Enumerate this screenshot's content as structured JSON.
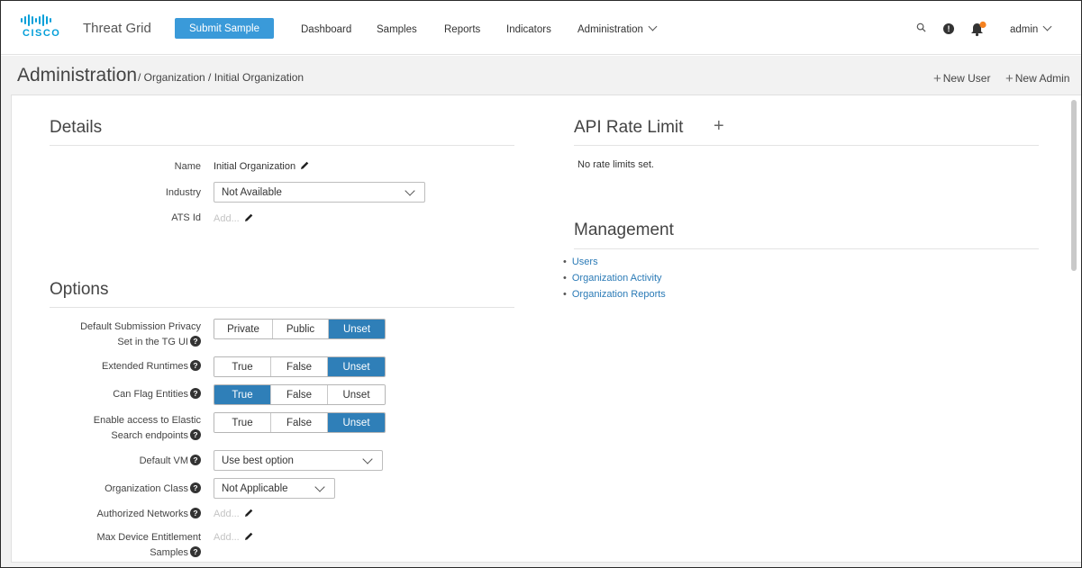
{
  "brand": {
    "logo_text": "CISCO",
    "app_title": "Threat Grid",
    "accent": "#3a9ad9"
  },
  "topnav": {
    "submit_label": "Submit Sample",
    "links": [
      "Dashboard",
      "Samples",
      "Reports",
      "Indicators",
      "Administration"
    ],
    "user": "admin",
    "icons": [
      "search-icon",
      "help-icon",
      "bell-icon"
    ]
  },
  "breadcrumb": {
    "root": "Administration",
    "rest": "/ Organization / Initial Organization"
  },
  "header_actions": {
    "new_user": "New User",
    "new_admin": "New Admin"
  },
  "details": {
    "title": "Details",
    "name_label": "Name",
    "name_value": "Initial Organization",
    "industry_label": "Industry",
    "industry_value": "Not Available",
    "ats_label": "ATS Id",
    "ats_placeholder": "Add..."
  },
  "options": {
    "title": "Options",
    "privacy_label_1": "Default Submission Privacy",
    "privacy_label_2": "Set in the TG UI",
    "privacy_opts": [
      "Private",
      "Public",
      "Unset"
    ],
    "extended_label": "Extended Runtimes",
    "extended_opts": [
      "True",
      "False",
      "Unset"
    ],
    "flag_label": "Can Flag Entities",
    "flag_opts": [
      "True",
      "False",
      "Unset"
    ],
    "elastic_label_1": "Enable access to Elastic",
    "elastic_label_2": "Search endpoints",
    "elastic_opts": [
      "True",
      "False",
      "Unset"
    ],
    "vm_label": "Default VM",
    "vm_value": "Use best option",
    "class_label": "Organization Class",
    "class_value": "Not Applicable",
    "networks_label": "Authorized Networks",
    "networks_placeholder": "Add...",
    "max_label_1": "Max Device Entitlement",
    "max_label_2": "Samples",
    "max_placeholder": "Add...",
    "selected": {
      "privacy": "Unset",
      "extended": "Unset",
      "flag": "True",
      "elastic": "Unset"
    }
  },
  "api": {
    "title": "API Rate Limit",
    "note": "No rate limits set."
  },
  "management": {
    "title": "Management",
    "links": [
      "Users",
      "Organization Activity",
      "Organization Reports"
    ]
  }
}
